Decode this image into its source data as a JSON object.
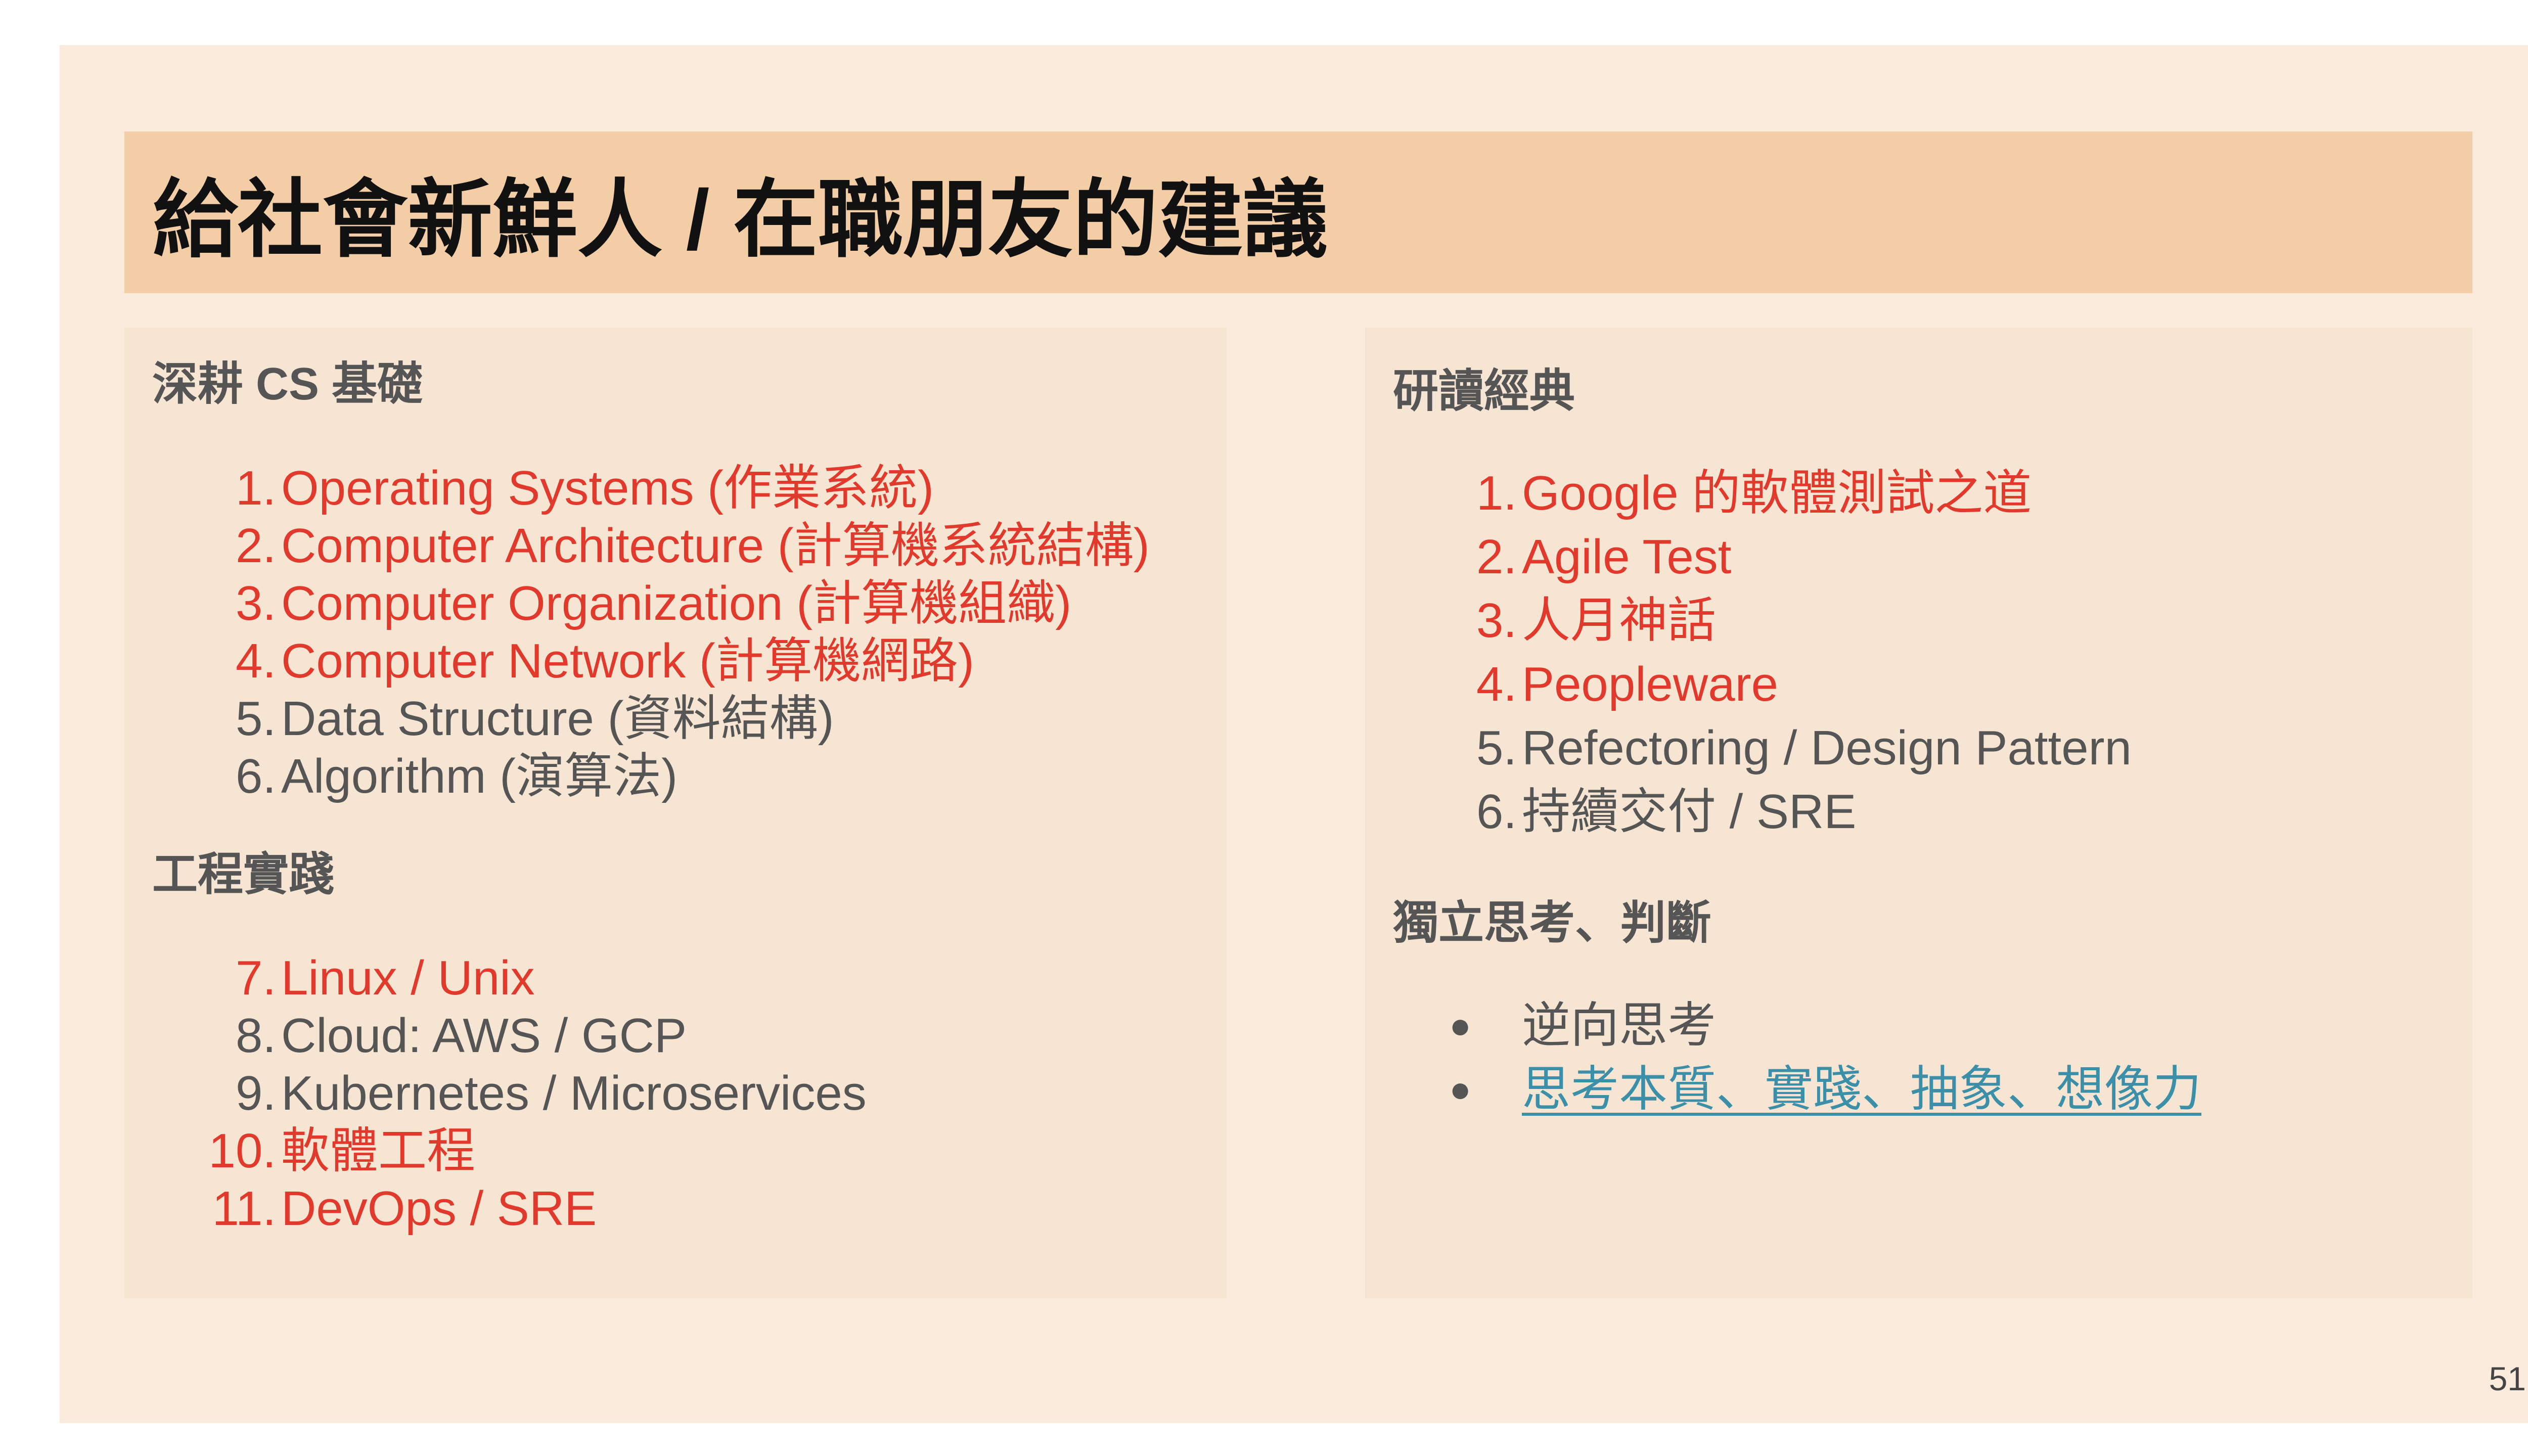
{
  "title": "給社會新鮮人 / 在職朋友的建議",
  "left_panel": {
    "sections": [
      {
        "heading": "深耕 CS 基礎",
        "items": [
          {
            "num": "1.",
            "text": "Operating Systems (作業系統)",
            "color": "#e13a2c"
          },
          {
            "num": "2.",
            "text": "Computer Architecture (計算機系統結構)",
            "color": "#e13a2c"
          },
          {
            "num": "3.",
            "text": "Computer Organization (計算機組織)",
            "color": "#e13a2c"
          },
          {
            "num": "4.",
            "text": "Computer Network (計算機網路)",
            "color": "#e13a2c"
          },
          {
            "num": "5.",
            "text": "Data Structure (資料結構)",
            "color": "#555555"
          },
          {
            "num": "6.",
            "text": "Algorithm (演算法)",
            "color": "#555555"
          }
        ]
      },
      {
        "heading": "工程實踐",
        "items": [
          {
            "num": "7.",
            "text": "Linux / Unix",
            "color": "#e13a2c"
          },
          {
            "num": "8.",
            "text": "Cloud: AWS / GCP",
            "color": "#555555"
          },
          {
            "num": "9.",
            "text": "Kubernetes / Microservices",
            "color": "#555555"
          },
          {
            "num": "10.",
            "text": "軟體工程",
            "color": "#e13a2c"
          },
          {
            "num": "11.",
            "text": "DevOps / SRE",
            "color": "#e13a2c"
          }
        ]
      }
    ]
  },
  "right_panel": {
    "sections": [
      {
        "heading": "研讀經典",
        "items": [
          {
            "num": "1.",
            "text": "Google 的軟體測試之道",
            "color": "#e13a2c"
          },
          {
            "num": "2.",
            "text": "Agile Test",
            "color": "#e13a2c"
          },
          {
            "num": "3.",
            "text": "人月神話",
            "color": "#e13a2c"
          },
          {
            "num": "4.",
            "text": "Peopleware",
            "color": "#e13a2c"
          },
          {
            "num": "5.",
            "text": "Refectoring / Design Pattern",
            "color": "#555555"
          },
          {
            "num": "6.",
            "text": "持續交付 / SRE",
            "color": "#555555"
          }
        ]
      },
      {
        "heading": "獨立思考、判斷",
        "bullets": [
          {
            "bullet": "●",
            "text": "逆向思考",
            "is_link": false
          },
          {
            "bullet": "●",
            "text": "思考本質、實踐、抽象、想像力",
            "is_link": true
          }
        ]
      }
    ]
  },
  "page_number": "51",
  "colors": {
    "slide_background": "#faebdc",
    "title_bar": "#f2cda6",
    "panel": "#f7e5d3",
    "highlight_red": "#e13a2c",
    "body_gray": "#555555",
    "link_teal": "#3c8fa8"
  }
}
